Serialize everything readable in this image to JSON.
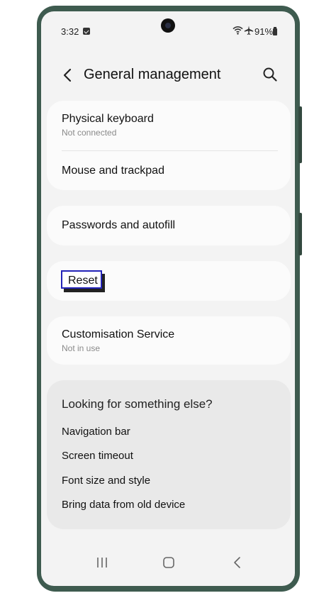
{
  "status_bar": {
    "time": "3:32",
    "battery": "91%",
    "icons": [
      "calendar-check-icon",
      "wifi-icon",
      "airplane-icon",
      "battery-icon"
    ]
  },
  "header": {
    "title": "General management",
    "back_icon": "chevron-left-icon",
    "search_icon": "search-icon"
  },
  "sections": {
    "physical_keyboard": {
      "title": "Physical keyboard",
      "subtitle": "Not connected"
    },
    "mouse_trackpad": {
      "title": "Mouse and trackpad"
    },
    "passwords_autofill": {
      "title": "Passwords and autofill"
    },
    "reset": {
      "title": "Reset"
    },
    "customisation": {
      "title": "Customisation Service",
      "subtitle": "Not in use"
    }
  },
  "suggestions": {
    "title": "Looking for something else?",
    "links": [
      "Navigation bar",
      "Screen timeout",
      "Font size and style",
      "Bring data from old device"
    ]
  },
  "nav_bar": {
    "icons": [
      "recent-apps-icon",
      "home-icon",
      "back-icon"
    ]
  },
  "colors": {
    "phone_frame": "#3e5b4f",
    "screen_bg": "#f3f3f3",
    "card_bg": "#fbfbfb",
    "suggest_bg": "#e9e9e9",
    "highlight_border": "#2323b8"
  }
}
